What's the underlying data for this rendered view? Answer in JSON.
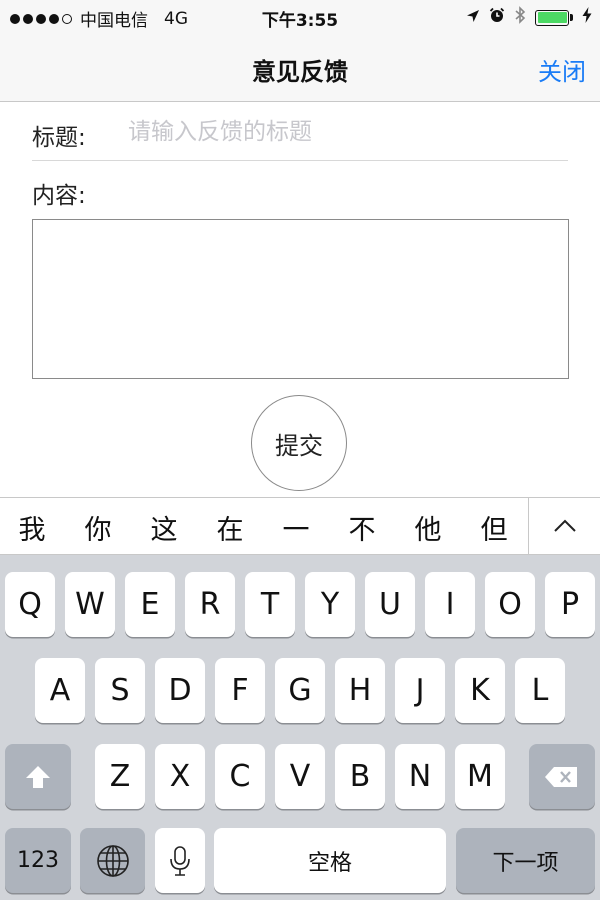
{
  "status_bar": {
    "carrier": "中国电信",
    "network": "4G",
    "time": "下午3:55",
    "battery_color": "#4cd964",
    "icons": [
      "location-arrow-icon",
      "alarm-icon",
      "bluetooth-icon",
      "battery-icon",
      "charging-bolt-icon"
    ]
  },
  "nav": {
    "title": "意见反馈",
    "close_label": "关闭",
    "accent_color": "#1a7cf6"
  },
  "form": {
    "title_label": "标题:",
    "title_placeholder": "请输入反馈的标题",
    "title_value": "",
    "content_label": "内容:",
    "content_value": "",
    "submit_label": "提交"
  },
  "candidates": {
    "items": [
      "我",
      "你",
      "这",
      "在",
      "一",
      "不",
      "他",
      "但"
    ],
    "expand_icon": "chevron-up-icon"
  },
  "keyboard": {
    "row1": [
      "Q",
      "W",
      "E",
      "R",
      "T",
      "Y",
      "U",
      "I",
      "O",
      "P"
    ],
    "row2": [
      "A",
      "S",
      "D",
      "F",
      "G",
      "H",
      "J",
      "K",
      "L"
    ],
    "row3": [
      "Z",
      "X",
      "C",
      "V",
      "B",
      "N",
      "M"
    ],
    "numbers_label": "123",
    "space_label": "空格",
    "next_label": "下一项",
    "shift_icon": "shift-arrow-icon",
    "delete_icon": "backspace-icon",
    "globe_icon": "globe-icon",
    "mic_icon": "microphone-icon"
  }
}
